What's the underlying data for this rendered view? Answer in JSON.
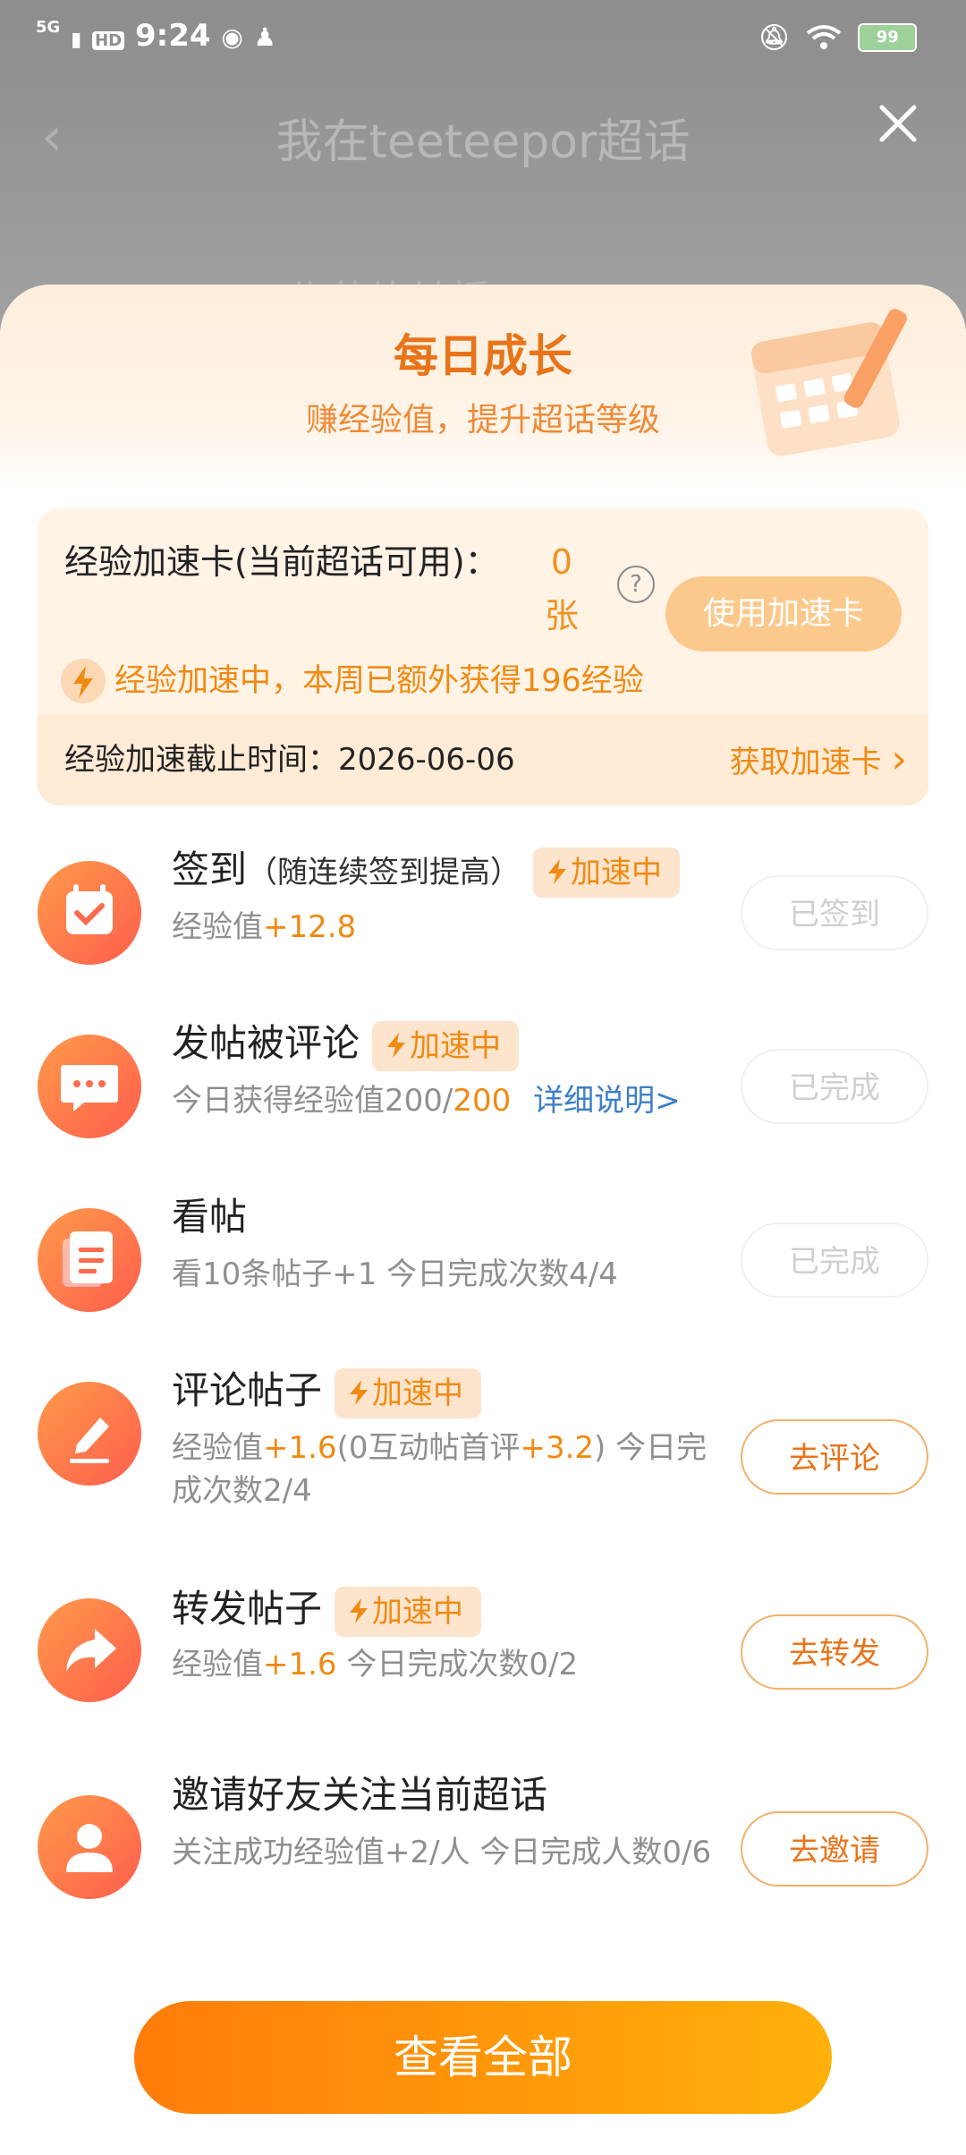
{
  "status_bar": {
    "network": "5G",
    "hd": "HD",
    "time": "9:24",
    "battery": "99"
  },
  "background_page": {
    "title": "我在teeteepor超话",
    "peek_text": "仆若练转播"
  },
  "sheet": {
    "title": "每日成长",
    "subtitle": "赚经验值，提升超话等级",
    "speed_card": {
      "label": "经验加速卡(当前超话可用)：",
      "count": "0张",
      "help": "?",
      "use_button": "使用加速卡",
      "boost_status": "经验加速中，本周已额外获得196经验",
      "deadline": "经验加速截止时间：2026-06-06",
      "get_card": "获取加速卡",
      "get_card_arrow": "›"
    },
    "boost_badge": "加速中",
    "tasks": [
      {
        "icon": "calendar-check-icon",
        "title": "签到",
        "note": "（随连续签到提高）",
        "boost": true,
        "sub_a": "经验值",
        "sub_b": "+12.8",
        "button": "已签到",
        "state": "done"
      },
      {
        "icon": "comment-bubble-icon",
        "title": "发帖被评论",
        "boost": true,
        "sub_a": "今日获得经验值200/",
        "sub_b": "200",
        "link": "详细说明>",
        "button": "已完成",
        "state": "done"
      },
      {
        "icon": "document-icon",
        "title": "看帖",
        "boost": false,
        "sub_a": "看10条帖子+1   今日完成次数4/4",
        "button": "已完成",
        "state": "done"
      },
      {
        "icon": "pencil-icon",
        "title": "评论帖子",
        "boost": true,
        "sub_a": "经验值",
        "sub_b": "+1.6",
        "sub_c": "(0互动帖首评",
        "sub_d": "+3.2",
        "sub_e": ")  今日完成次数2/4",
        "button": "去评论",
        "state": "go"
      },
      {
        "icon": "share-arrow-icon",
        "title": "转发帖子",
        "boost": true,
        "sub_a": "经验值",
        "sub_b": "+1.6",
        "sub_c": "  今日完成次数0/2",
        "button": "去转发",
        "state": "go"
      },
      {
        "icon": "person-icon",
        "title": "邀请好友关注当前超话",
        "boost": false,
        "sub_a": "关注成功经验值+2/人  今日完成人数0/6",
        "button": "去邀请",
        "state": "go"
      }
    ],
    "view_all": "查看全部"
  },
  "colors": {
    "accent": "#f08a12",
    "title_orange": "#e8741a",
    "icon_gradient": [
      "#ff9a4a",
      "#ff5e4d"
    ]
  }
}
